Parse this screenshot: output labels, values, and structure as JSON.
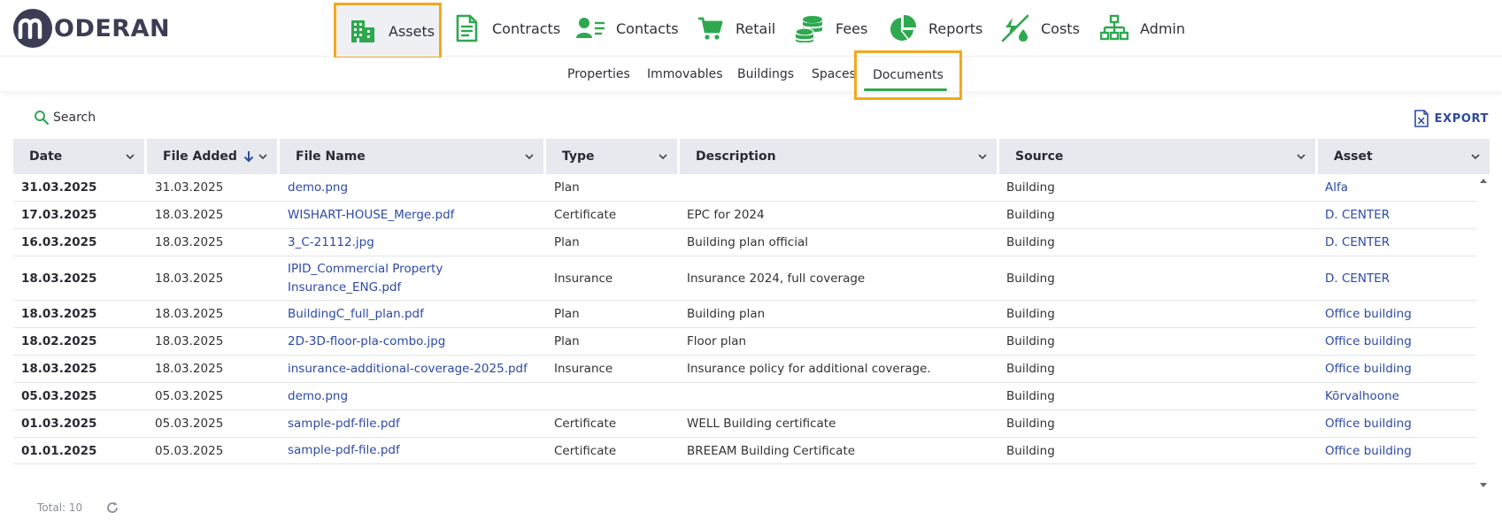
{
  "brand": {
    "name": "ODERAN",
    "badge_letter": "m"
  },
  "main_nav": [
    {
      "label": "Assets",
      "icon": "buildings-icon"
    },
    {
      "label": "Contracts",
      "icon": "document-icon"
    },
    {
      "label": "Contacts",
      "icon": "contact-card-icon"
    },
    {
      "label": "Retail",
      "icon": "cart-icon"
    },
    {
      "label": "Fees",
      "icon": "coins-icon"
    },
    {
      "label": "Reports",
      "icon": "pie-chart-icon"
    },
    {
      "label": "Costs",
      "icon": "costs-icon"
    },
    {
      "label": "Admin",
      "icon": "org-chart-icon"
    }
  ],
  "sub_nav": [
    "Properties",
    "Immovables",
    "Buildings",
    "Spaces",
    "Documents"
  ],
  "toolbar": {
    "search_label": "Search",
    "export_label": "EXPORT"
  },
  "columns": [
    "Date",
    "File Added",
    "File Name",
    "Type",
    "Description",
    "Source",
    "Asset"
  ],
  "rows": [
    {
      "date": "31.03.2025",
      "added": "31.03.2025",
      "name": "demo.png",
      "type": "Plan",
      "description": "",
      "source": "Building",
      "asset": "Alfa"
    },
    {
      "date": "17.03.2025",
      "added": "18.03.2025",
      "name": "WISHART-HOUSE_Merge.pdf",
      "type": "Certificate",
      "description": "EPC for 2024",
      "source": "Building",
      "asset": "D. CENTER"
    },
    {
      "date": "16.03.2025",
      "added": "18.03.2025",
      "name": "3_C-21112.jpg",
      "type": "Plan",
      "description": "Building plan official",
      "source": "Building",
      "asset": "D. CENTER"
    },
    {
      "date": "18.03.2025",
      "added": "18.03.2025",
      "name": "IPID_Commercial Property Insurance_ENG.pdf",
      "type": "Insurance",
      "description": "Insurance 2024, full coverage",
      "source": "Building",
      "asset": "D. CENTER"
    },
    {
      "date": "18.03.2025",
      "added": "18.03.2025",
      "name": "BuildingC_full_plan.pdf",
      "type": "Plan",
      "description": "Building plan",
      "source": "Building",
      "asset": "Office building"
    },
    {
      "date": "18.02.2025",
      "added": "18.03.2025",
      "name": "2D-3D-floor-pla-combo.jpg",
      "type": "Plan",
      "description": "Floor plan",
      "source": "Building",
      "asset": "Office building"
    },
    {
      "date": "18.03.2025",
      "added": "18.03.2025",
      "name": "insurance-additional-coverage-2025.pdf",
      "type": "Insurance",
      "description": "Insurance policy for additional coverage.",
      "source": "Building",
      "asset": "Office building"
    },
    {
      "date": "05.03.2025",
      "added": "05.03.2025",
      "name": "demo.png",
      "type": "",
      "description": "",
      "source": "Building",
      "asset": "Kõrvalhoone"
    },
    {
      "date": "01.03.2025",
      "added": "05.03.2025",
      "name": "sample-pdf-file.pdf",
      "type": "Certificate",
      "description": "WELL Building certificate",
      "source": "Building",
      "asset": "Office building"
    },
    {
      "date": "01.01.2025",
      "added": "05.03.2025",
      "name": "sample-pdf-file.pdf",
      "type": "Certificate",
      "description": "BREEAM Building Certificate",
      "source": "Building",
      "asset": "Office building"
    }
  ],
  "footer": {
    "total_label": "Total: 10"
  },
  "colors": {
    "accent_green": "#2fa84f",
    "highlight": "#f2a91d",
    "link": "#2d4aa8",
    "brand_dark": "#3b3d55"
  }
}
